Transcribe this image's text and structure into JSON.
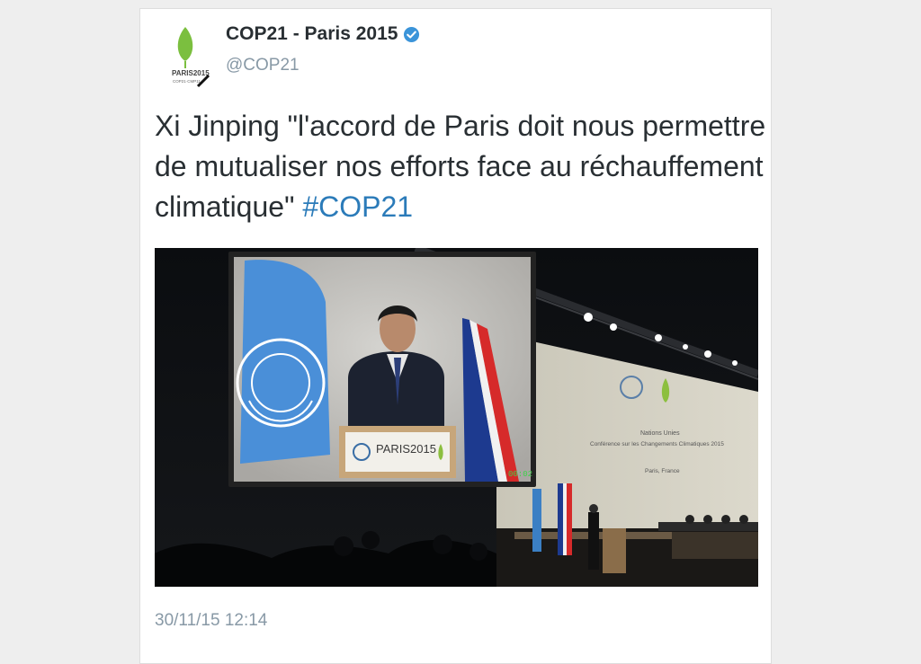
{
  "account": {
    "display_name": "COP21 - Paris 2015",
    "handle": "@COP21",
    "verified": true,
    "avatar_icon": "cop21-leaf-logo-icon",
    "avatar_text": "PARIS2015 COP21·CMP11"
  },
  "tweet": {
    "text": "Xi Jinping \"l'accord de Paris doit nous permettre de mutualiser nos efforts face au réchauffement climatique\" ",
    "hashtag": "#COP21"
  },
  "photo": {
    "podium_text": "PARIS2015",
    "backdrop_line1": "Nations Unies",
    "backdrop_line2": "Conférence sur les Changements Climatiques 2015",
    "backdrop_line3": "Paris, France",
    "screen_timer": "00:02"
  },
  "timestamp": "30/11/15 12:14",
  "colors": {
    "hashtag": "#2b7bb9",
    "verified": "#3b94d9",
    "muted": "#8899a6",
    "text": "#292f33"
  }
}
